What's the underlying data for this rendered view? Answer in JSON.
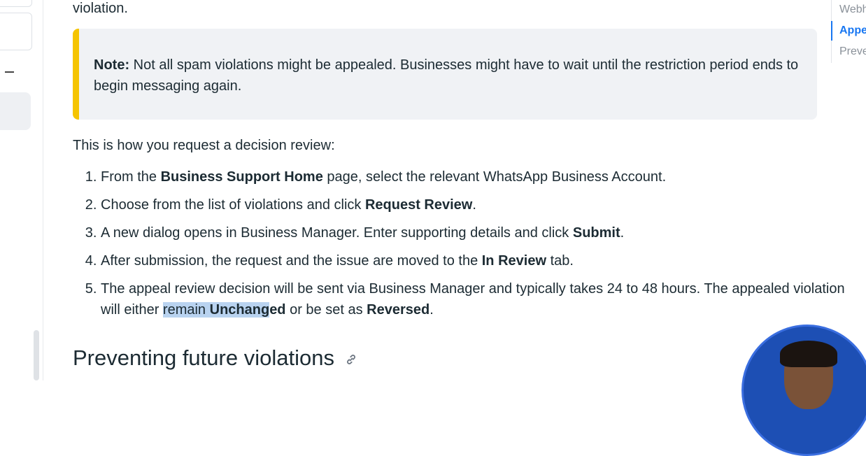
{
  "top_text": "violation.",
  "note": {
    "label": "Note:",
    "text": " Not all spam violations might be appealed. Businesses might have to wait until the restriction period ends to begin messaging again."
  },
  "intro": "This is how you request a decision review:",
  "steps": [
    {
      "a": "From the ",
      "b": "Business Support Home",
      "c": " page, select the relevant WhatsApp Business Account."
    },
    {
      "a": "Choose from the list of violations and click ",
      "b": "Request Review",
      "c": "."
    },
    {
      "a": "A new dialog opens in Business Manager. Enter supporting details and click ",
      "b": "Submit",
      "c": "."
    },
    {
      "a": "After submission, the request and the issue are moved to the ",
      "b": "In Review",
      "c": " tab."
    },
    {
      "a": "The appeal review decision will be sent via Business Manager and typically takes 24 to 48 hours. The appealed violation will either ",
      "hl1": "remain ",
      "hl2": "Unchang",
      "b_rest": "ed",
      "mid": " or be set as ",
      "b2": "Reversed",
      "end": "."
    }
  ],
  "heading": "Preventing future violations",
  "toc": [
    "Webh",
    "Appe",
    "Preve"
  ],
  "colors": {
    "accent": "#1877f2",
    "note_bar": "#f5c400",
    "note_bg": "#f0f2f5",
    "highlight": "#b9d3f0"
  },
  "icons": {
    "heading_link": "link-icon"
  }
}
